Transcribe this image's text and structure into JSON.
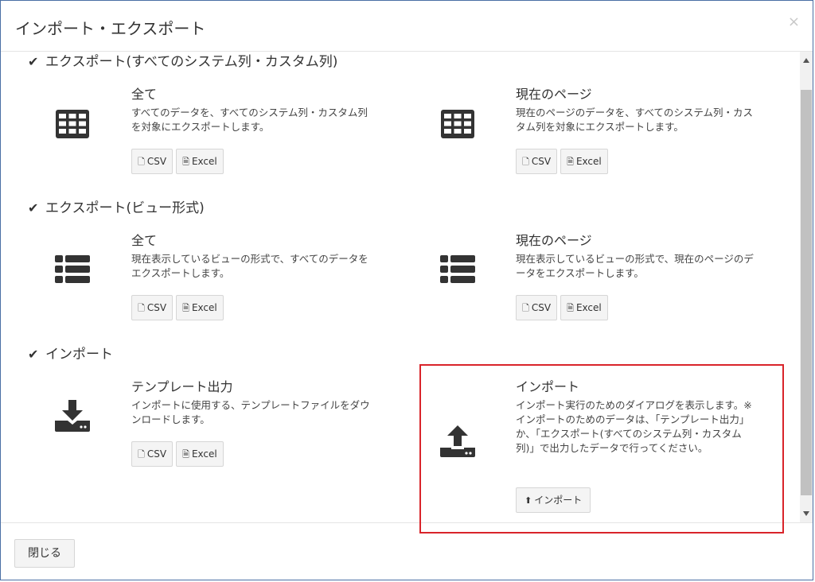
{
  "dialog": {
    "title": "インポート・エクスポート",
    "close_symbol": "×",
    "footer_close_label": "閉じる"
  },
  "sections": [
    {
      "title": "エクスポート(すべてのシステム列・カスタム列)",
      "icon": "table-icon",
      "cards": [
        {
          "title": "全て",
          "description": "すべてのデータを、すべてのシステム列・カスタム列を対象にエクスポートします。",
          "buttons": [
            "CSV",
            "Excel"
          ]
        },
        {
          "title": "現在のページ",
          "description": "現在のページのデータを、すべてのシステム列・カスタム列を対象にエクスポートします。",
          "buttons": [
            "CSV",
            "Excel"
          ]
        }
      ]
    },
    {
      "title": "エクスポート(ビュー形式)",
      "icon": "list-icon",
      "cards": [
        {
          "title": "全て",
          "description": "現在表示しているビューの形式で、すべてのデータをエクスポートします。",
          "buttons": [
            "CSV",
            "Excel"
          ]
        },
        {
          "title": "現在のページ",
          "description": "現在表示しているビューの形式で、現在のページのデータをエクスポートします。",
          "buttons": [
            "CSV",
            "Excel"
          ]
        }
      ]
    },
    {
      "title": "インポート",
      "cards": [
        {
          "title": "テンプレート出力",
          "icon": "download-icon",
          "description": "インポートに使用する、テンプレートファイルをダウンロードします。",
          "buttons": [
            "CSV",
            "Excel"
          ]
        },
        {
          "title": "インポート",
          "icon": "upload-icon",
          "description": "インポート実行のためのダイアログを表示します。※インポートのためのデータは、「テンプレート出力」か、「エクスポート(すべてのシステム列・カスタム列)」で出力したデータで行ってください。",
          "buttons": [
            "インポート"
          ]
        }
      ]
    }
  ],
  "colors": {
    "highlight_border": "#d9242a",
    "icon": "#333333"
  }
}
